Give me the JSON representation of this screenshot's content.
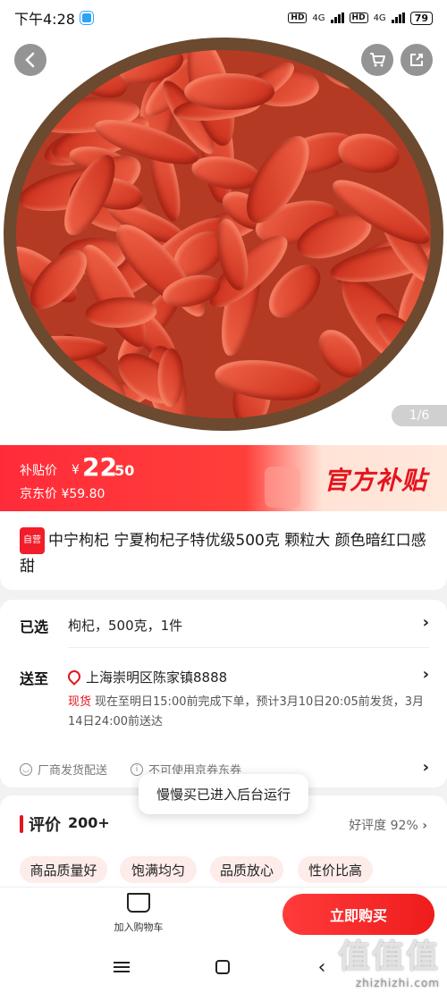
{
  "status_bar": {
    "time": "下午4:28",
    "network_1": "4G",
    "network_2": "4G",
    "battery": "79"
  },
  "gallery": {
    "counter": "1/6",
    "back_icon": "back-arrow-icon",
    "cart_icon": "cart-icon",
    "share_icon": "share-icon"
  },
  "subsidy": {
    "label": "补贴价",
    "currency": "¥",
    "price_int": "22",
    "price_dec": ".50",
    "jd_label": "京东价",
    "jd_price": "¥59.80",
    "brand_text": "官方补贴",
    "banner_color": "#ff2b3a"
  },
  "product": {
    "self_tag": "自营",
    "title": "中宁枸杞 宁夏枸杞子特优级500克 颗粒大 颜色暗红口感甜"
  },
  "options": {
    "selected_label": "已选",
    "selected_value": "枸杞，500克，1件",
    "ship_label": "送至",
    "address": "上海崇明区陈家镇8888",
    "stock": "现货",
    "delivery": "现在至明日15:00前完成下单，预计3月10日20:05前发货，3月14日24:00前送达",
    "service_1": "厂商发货配送",
    "service_2": "不可使用京券东券"
  },
  "reviews": {
    "title": "评价",
    "count": "200+",
    "rate": "好评度 92%",
    "tags": [
      "商品质量好",
      "饱满均匀",
      "品质放心",
      "性价比高"
    ]
  },
  "toast": {
    "message": "慢慢买已进入后台运行"
  },
  "actions": {
    "cart_label": "加入购物车",
    "buy_label": "立即购买",
    "accent": "#ef1c1c"
  },
  "watermark": {
    "main": "值值值",
    "sub": "zhizhizhi.com"
  }
}
